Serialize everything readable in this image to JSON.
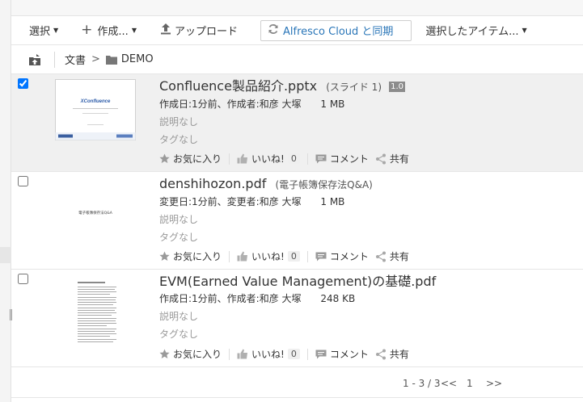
{
  "toolbar": {
    "select_label": "選択",
    "create_label": "作成...",
    "upload_label": "アップロード",
    "sync_label": "Alfresco Cloud と同期",
    "selected_items_label": "選択したアイテム..."
  },
  "breadcrumb": {
    "root": "文書",
    "separator": ">",
    "current": "DEMO"
  },
  "documents": [
    {
      "selected": true,
      "title": "Confluence製品紹介.pptx",
      "subtitle": "(スライド 1)",
      "version": "1.0",
      "meta": "作成日:1分前、作成者:和彦 大塚",
      "size": "1 MB",
      "description": "説明なし",
      "tags": "タグなし",
      "favorite_label": "お気に入り",
      "like_label": "いいね!",
      "like_count": "0",
      "comment_label": "コメント",
      "share_label": "共有",
      "thumb_text": "XConfluence"
    },
    {
      "selected": false,
      "title": "denshihozon.pdf",
      "subtitle": "(電子帳簿保存法Q&A)",
      "meta": "変更日:1分前、変更者:和彦 大塚",
      "size": "1 MB",
      "description": "説明なし",
      "tags": "タグなし",
      "favorite_label": "お気に入り",
      "like_label": "いいね!",
      "like_count": "0",
      "comment_label": "コメント",
      "share_label": "共有",
      "thumb_text": "電子帳簿保存法Q&A"
    },
    {
      "selected": false,
      "title": "EVM(Earned Value Management)の基礎.pdf",
      "meta": "作成日:1分前、作成者:和彦 大塚",
      "size": "248 KB",
      "description": "説明なし",
      "tags": "タグなし",
      "favorite_label": "お気に入り",
      "like_label": "いいね!",
      "like_count": "0",
      "comment_label": "コメント",
      "share_label": "共有"
    }
  ],
  "pager": {
    "range": "1 - 3 / 3",
    "prev": "<<",
    "page": "1",
    "next": ">>"
  },
  "icons": {
    "create": "plus-icon",
    "upload": "upload-icon",
    "sync": "sync-icon",
    "up_folder": "parent-folder-icon",
    "folder": "folder-icon",
    "favorite": "star-icon",
    "like": "thumbs-up-icon",
    "comment": "comment-icon",
    "share": "share-icon"
  },
  "colors": {
    "accent": "#2a76b8",
    "selected_row": "#f0f0f0",
    "version_badge": "#8c8c8c",
    "muted_text": "#999999"
  }
}
